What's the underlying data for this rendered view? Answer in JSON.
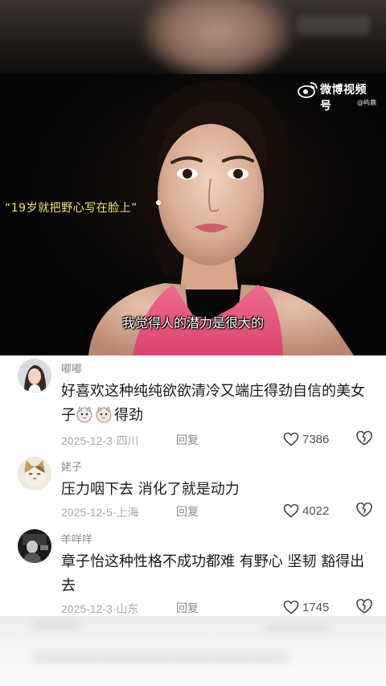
{
  "video": {
    "watermark_title": "微博视频号",
    "watermark_user": "@屿鹿",
    "quote": "“19岁就把野心写在脸上”",
    "subtitle": "我觉得人的潜力是很大的"
  },
  "comments": [
    {
      "username": "嘟嘟",
      "text_line1": "好喜欢这种纯纯欲欲清冷又端庄得劲自信的美女",
      "text_line2_prefix": "子",
      "text_line2_suffix": "得劲",
      "emojis": [
        "cat-face-emoji",
        "cat-face-emoji"
      ],
      "date": "2025-12-3",
      "location": "四川",
      "reply_label": "回复",
      "likes": "7386"
    },
    {
      "username": "姥子",
      "text_line1": "压力咽下去 消化了就是动力",
      "date": "2025-12-5",
      "location": "上海",
      "reply_label": "回复",
      "likes": "4022"
    },
    {
      "username": "羊咩咩",
      "text_line1": "章子怡这种性格不成功都难 有野心 坚韧 豁得出",
      "text_line2": "去",
      "date": "2025-12-3",
      "location": "山东",
      "reply_label": "回复",
      "likes": "1745"
    }
  ],
  "meta_separator": "·",
  "colors": {
    "quote": "#f4e37a",
    "username": "#8c8c8c",
    "text": "#1a1a1a",
    "meta": "#a8a8a8",
    "top_dress": "#e8557a"
  }
}
